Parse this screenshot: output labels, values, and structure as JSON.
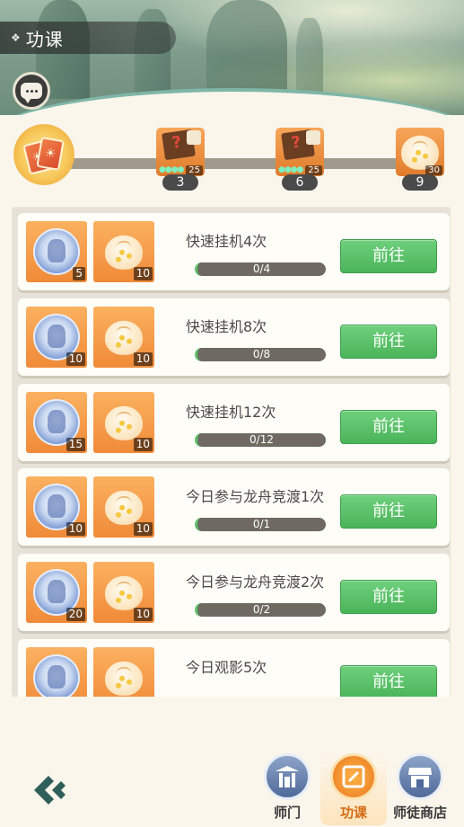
{
  "header": {
    "title": "功课",
    "title_prefix_icon": "diamond-icon",
    "chat_icon": "chat-bubble-icon"
  },
  "progress_track": {
    "start_icon": "cards-icon",
    "milestones": [
      {
        "label": "3",
        "reward_count": "25",
        "reward_icon": "mystery-scroll-icon"
      },
      {
        "label": "6",
        "reward_count": "25",
        "reward_icon": "mystery-scroll-icon"
      },
      {
        "label": "9",
        "reward_count": "30",
        "reward_icon": "dumpling-icon"
      }
    ]
  },
  "tasks": [
    {
      "name": "快速挂机4次",
      "reward1_qty": "5",
      "reward2_qty": "10",
      "progress_text": "0/4",
      "progress": 0,
      "button": "前往"
    },
    {
      "name": "快速挂机8次",
      "reward1_qty": "10",
      "reward2_qty": "10",
      "progress_text": "0/8",
      "progress": 0,
      "button": "前往"
    },
    {
      "name": "快速挂机12次",
      "reward1_qty": "15",
      "reward2_qty": "10",
      "progress_text": "0/12",
      "progress": 0,
      "button": "前往"
    },
    {
      "name": "今日参与龙舟竞渡1次",
      "reward1_qty": "10",
      "reward2_qty": "10",
      "progress_text": "0/1",
      "progress": 0,
      "button": "前往"
    },
    {
      "name": "今日参与龙舟竞渡2次",
      "reward1_qty": "20",
      "reward2_qty": "10",
      "progress_text": "0/2",
      "progress": 0,
      "button": "前往"
    },
    {
      "name": "今日观影5次",
      "reward1_qty": "",
      "reward2_qty": "",
      "progress_text": "",
      "progress": 0,
      "button": "前往"
    }
  ],
  "bottom_nav": {
    "back_icon": "back-arrow-icon",
    "items": [
      {
        "label": "师门",
        "icon": "gate-icon",
        "active": false
      },
      {
        "label": "功课",
        "icon": "notebook-icon",
        "active": true
      },
      {
        "label": "师徒商店",
        "icon": "shop-icon",
        "active": false
      }
    ]
  },
  "colors": {
    "accent_green": "#4ab45a",
    "active_orange": "#e8791f",
    "background": "#fbf6ec"
  }
}
